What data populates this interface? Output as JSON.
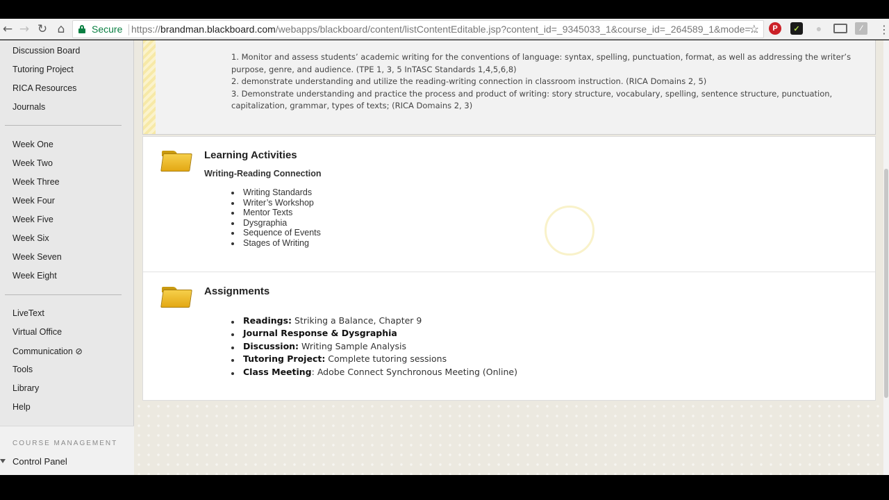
{
  "browser": {
    "secure_label": "Secure",
    "url_scheme": "https://",
    "url_host": "brandman.blackboard.com",
    "url_path": "/webapps/blackboard/content/listContentEditable.jsp?content_id=_9345033_1&course_id=_264589_1&mode=...",
    "star_icon": "☆"
  },
  "sidebar": {
    "top_items": [
      "Discussion Board",
      "Tutoring Project",
      "RICA Resources",
      "Journals"
    ],
    "weeks": [
      "Week One",
      "Week Two",
      "Week Three",
      "Week Four",
      "Week Five",
      "Week Six",
      "Week Seven",
      "Week Eight"
    ],
    "tools": [
      "LiveText",
      "Virtual Office",
      "Communication ⊘",
      "Tools",
      "Library",
      "Help"
    ],
    "course_management_title": "COURSE MANAGEMENT",
    "control_panel": "Control Panel"
  },
  "objectives": {
    "lines": [
      "1. Monitor and assess students’ academic writing for the conventions of language: syntax, spelling, punctuation, format, as well as addressing the writer’s",
      "purpose, genre, and audience. (TPE 1, 3, 5 InTASC Standards 1,4,5,6,8)",
      "2. demonstrate understanding and utilize the reading-writing connection in classroom instruction. (RICA Domains 2, 5)",
      "3. Demonstrate understanding and practice the process and product of writing: story structure, vocabulary, spelling, sentence structure, punctuation,",
      "capitalization, grammar, types of texts; (RICA Domains 2, 3)"
    ]
  },
  "learning_activities": {
    "title": "Learning Activities",
    "subtitle": "Writing-Reading Connection",
    "items": [
      "Writing Standards",
      "Writer’s Workshop",
      "Mentor Texts",
      "Dysgraphia",
      "Sequence of Events",
      "Stages of Writing"
    ]
  },
  "assignments": {
    "title": "Assignments",
    "items": [
      {
        "label": "Readings:",
        "text": " Striking a Balance, Chapter 9"
      },
      {
        "label": "Journal Response & Dysgraphia",
        "text": ""
      },
      {
        "label": "Discussion:",
        "text": " Writing Sample Analysis"
      },
      {
        "label": "Tutoring Project:",
        "text": " Complete tutoring sessions"
      },
      {
        "label": "Class Meeting",
        "text": ": Adobe Connect Synchronous Meeting (Online)"
      }
    ]
  },
  "colors": {
    "secure_green": "#0b8043",
    "folder_yellow": "#f6cf4a",
    "sidebar_bg": "#e8e8e8"
  },
  "icons": [
    "back-icon",
    "forward-icon",
    "reload-icon",
    "home-icon",
    "lock-icon",
    "star-icon",
    "pinterest-icon",
    "checkmark-extension-icon",
    "cast-icon",
    "menu-icon",
    "folder-icon"
  ]
}
